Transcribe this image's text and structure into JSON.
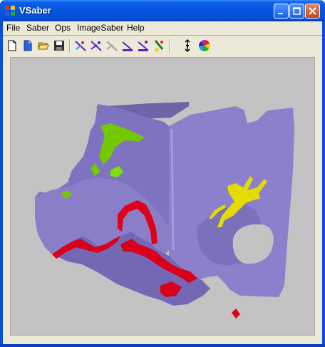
{
  "window": {
    "title": "VSaber",
    "controls": [
      "minimize",
      "maximize",
      "close"
    ]
  },
  "menu": [
    {
      "label": "File"
    },
    {
      "label": "Saber"
    },
    {
      "label": "Ops"
    },
    {
      "label": "ImageSaber"
    },
    {
      "label": "Help"
    }
  ],
  "toolbar": {
    "icons": [
      "new-file-icon",
      "new-document-icon",
      "open-folder-icon",
      "save-disk-icon",
      "saber-tool-1-icon",
      "saber-tool-2-icon",
      "saber-tool-3-icon",
      "saber-tool-4-icon",
      "saber-tool-5-icon",
      "saber-tool-6-icon",
      "vertical-spread-icon",
      "color-wheel-icon"
    ]
  },
  "viewport": {
    "description_colors": {
      "background": "#c4c2c2",
      "model": "#8a7ec8",
      "highlight_red": "#e0001a",
      "highlight_green": "#7cd000",
      "highlight_yellow": "#e8e000"
    }
  }
}
